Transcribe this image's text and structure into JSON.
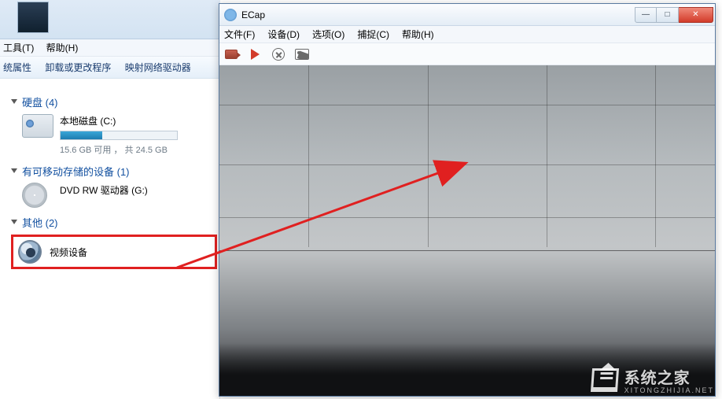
{
  "explorer": {
    "menu": {
      "tools": "工具(T)",
      "help": "帮助(H)"
    },
    "cmdbar": {
      "props": "统属性",
      "uninstall": "卸载或更改程序",
      "mapdrive": "映射网络驱动器"
    },
    "groups": {
      "hdd": {
        "label": "硬盘 (4)"
      },
      "removable": {
        "label": "有可移动存储的设备 (1)"
      },
      "other": {
        "label": "其他 (2)"
      }
    },
    "local_disk": {
      "name": "本地磁盘 (C:)",
      "sub": "15.6 GB 可用 ， 共 24.5 GB",
      "fill_percent": 36
    },
    "dvd": {
      "name": "DVD RW 驱动器 (G:)"
    },
    "video_device": {
      "name": "视频设备"
    }
  },
  "ecap": {
    "title": "ECap",
    "menu": {
      "file": "文件(F)",
      "device": "设备(D)",
      "options": "选项(O)",
      "capture": "捕捉(C)",
      "help": "帮助(H)"
    },
    "winbtns": {
      "min": "—",
      "max": "□",
      "close": "✕"
    }
  },
  "watermark": {
    "big": "系统之家",
    "small": "XITONGZHIJIA.NET"
  }
}
